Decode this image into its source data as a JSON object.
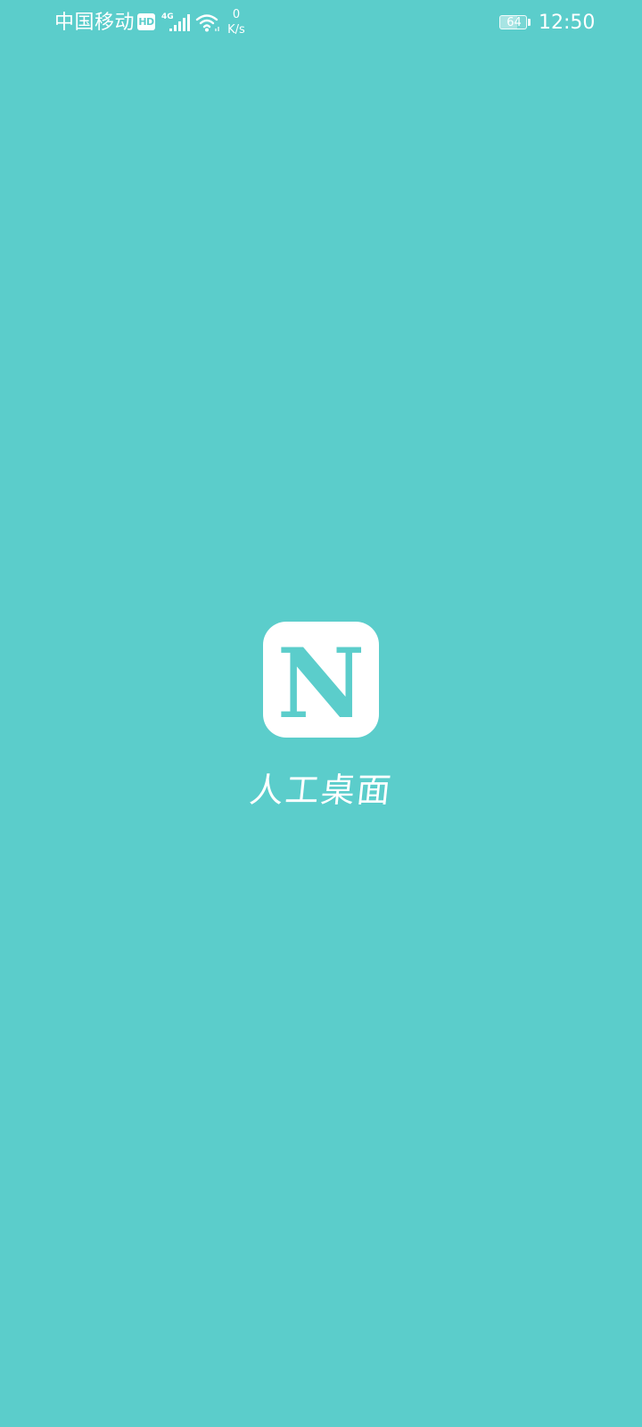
{
  "status_bar": {
    "carrier": "中国移动",
    "hd_badge": "HD",
    "network_type": "4G",
    "net_speed_value": "0",
    "net_speed_unit": "K/s",
    "battery_level": "64",
    "battery_fraction": 0.64,
    "time": "12:50",
    "icons": [
      "hd-icon",
      "signal-icon",
      "wifi-icon",
      "battery-icon"
    ]
  },
  "splash": {
    "logo_letter": "N",
    "app_name": "人工桌面"
  },
  "colors": {
    "background": "#5BCDCB",
    "foreground": "#FFFFFF"
  }
}
